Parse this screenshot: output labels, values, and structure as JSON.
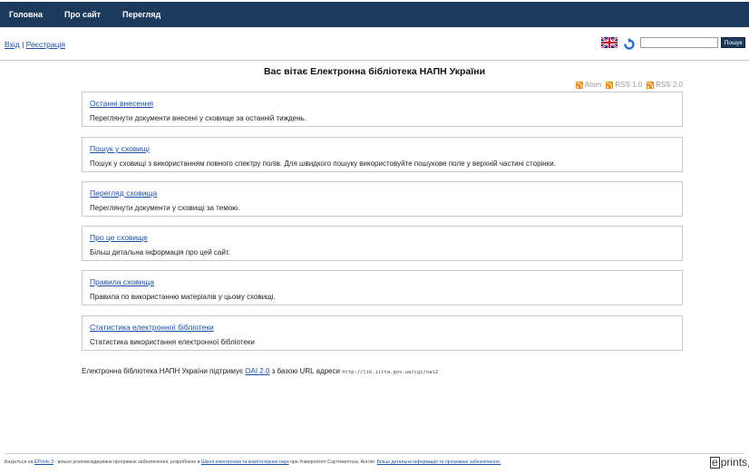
{
  "nav": {
    "items": [
      "Головна",
      "Про сайт",
      "Перегляд"
    ]
  },
  "userbar": {
    "login": "Вхід",
    "separator": "|",
    "register": "Реєстрація",
    "search_placeholder": "",
    "search_button": "Пошук"
  },
  "main": {
    "title": "Вас вітає Електронна бібліотека НАПН України",
    "feeds": [
      "Atom",
      "RSS 1.0",
      "RSS 2.0"
    ],
    "sections": [
      {
        "title": "Останні внесення",
        "desc": "Переглянути документи внесені у сховище за останній тиждень."
      },
      {
        "title": "Пошук у сховищі",
        "desc": "Пошук у сховищі з використанням повного спектру полів. Для швидкого пошуку використовуйте пошукове поле у верхній частині сторінки."
      },
      {
        "title": "Перегляд сховища",
        "desc": "Переглянути документи у сховищі за темою."
      },
      {
        "title": "Про це сховище",
        "desc": "Більш детальна інформація про цей сайт."
      },
      {
        "title": "Правила сховища",
        "desc": "Правила по використанню матеріалів у цьому сховищі."
      },
      {
        "title": "Статистика електронної бібліотеки",
        "desc": "Статистика використання електронної бібліотеки"
      }
    ],
    "oai": {
      "prefix": "Електронна бібліотека НАПН України підтримує",
      "link": "OAI 2.0",
      "middle": "з базою URL адреси",
      "url": "http://lib.iitta.gov.ua/cgi/oai2"
    }
  },
  "footer": {
    "t1": "Базується на",
    "eprints_link": "EPrints 3",
    "t2": "- вільно розповсюджуване програмне забезпечення, розроблене в",
    "school_link": "Школі електроніки та комп'ютерних наук",
    "t3": "при Університеті Саутгемптона. Англія.",
    "more_link": "Більш детальна інформація та програмне забезпечення.",
    "logo_e": "e",
    "logo_text": "prints"
  },
  "colors": {
    "nav_bg": "#1b3a5c",
    "link": "#1a4fa3",
    "rss": "#f08b1d"
  }
}
